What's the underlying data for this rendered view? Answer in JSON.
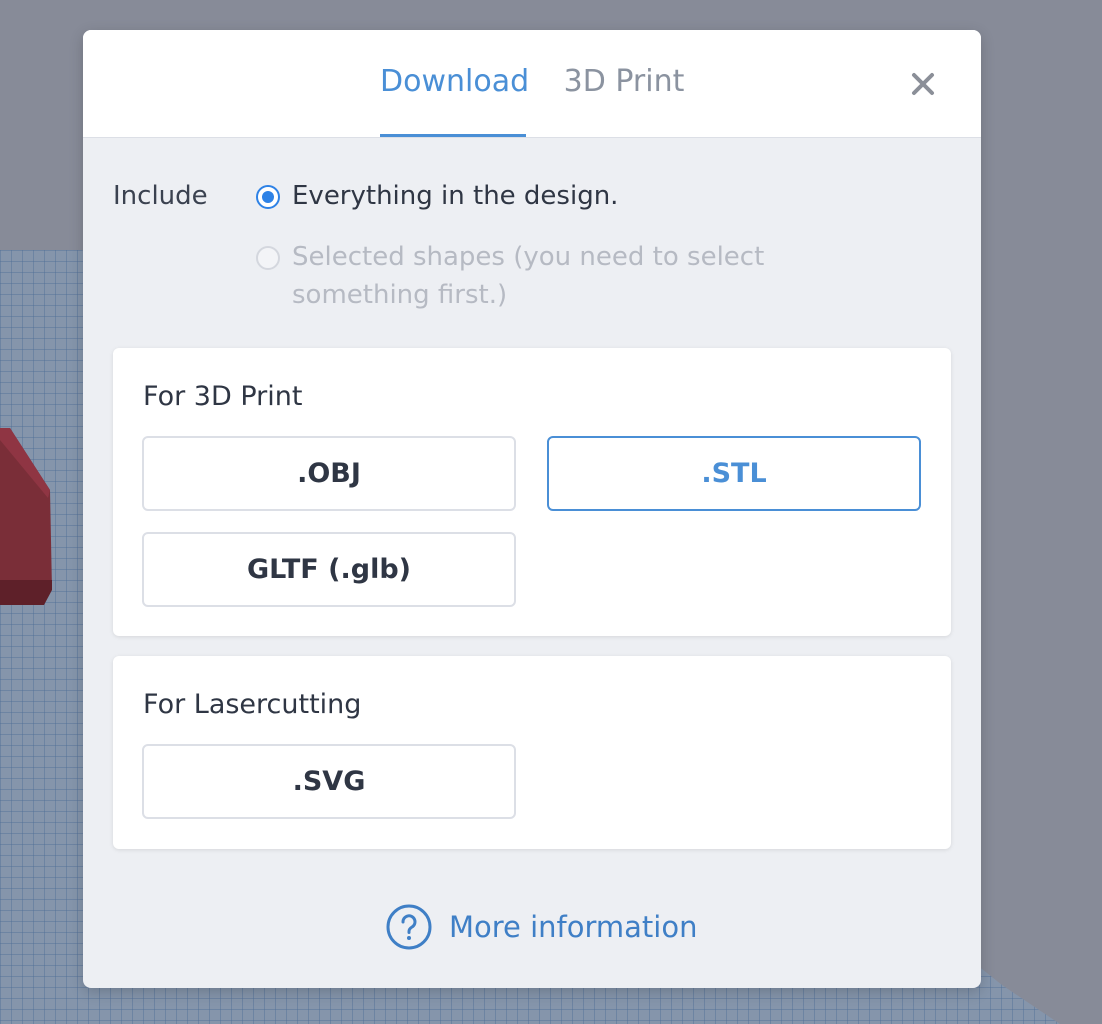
{
  "dialog": {
    "tabs": [
      {
        "label": "Download",
        "active": true
      },
      {
        "label": "3D Print",
        "active": false
      }
    ],
    "close_icon": "close-icon"
  },
  "include": {
    "label": "Include",
    "options": [
      {
        "label": "Everything in the design.",
        "selected": true,
        "enabled": true
      },
      {
        "label": "Selected shapes (you need to select something first.)",
        "selected": false,
        "enabled": false
      }
    ]
  },
  "sections": {
    "print3d": {
      "title": "For 3D Print",
      "buttons": [
        {
          "label": ".OBJ",
          "selected": false
        },
        {
          "label": ".STL",
          "selected": true
        },
        {
          "label": "GLTF (.glb)",
          "selected": false
        }
      ]
    },
    "laser": {
      "title": "For Lasercutting",
      "buttons": [
        {
          "label": ".SVG",
          "selected": false
        }
      ]
    }
  },
  "footer": {
    "more_info_label": "More information",
    "icon": "question-circle-icon"
  },
  "colors": {
    "accent": "#4a8fd6",
    "radio_active": "#2e82e6",
    "backdrop": "#878b98",
    "dialog_bg": "#edeff3"
  }
}
